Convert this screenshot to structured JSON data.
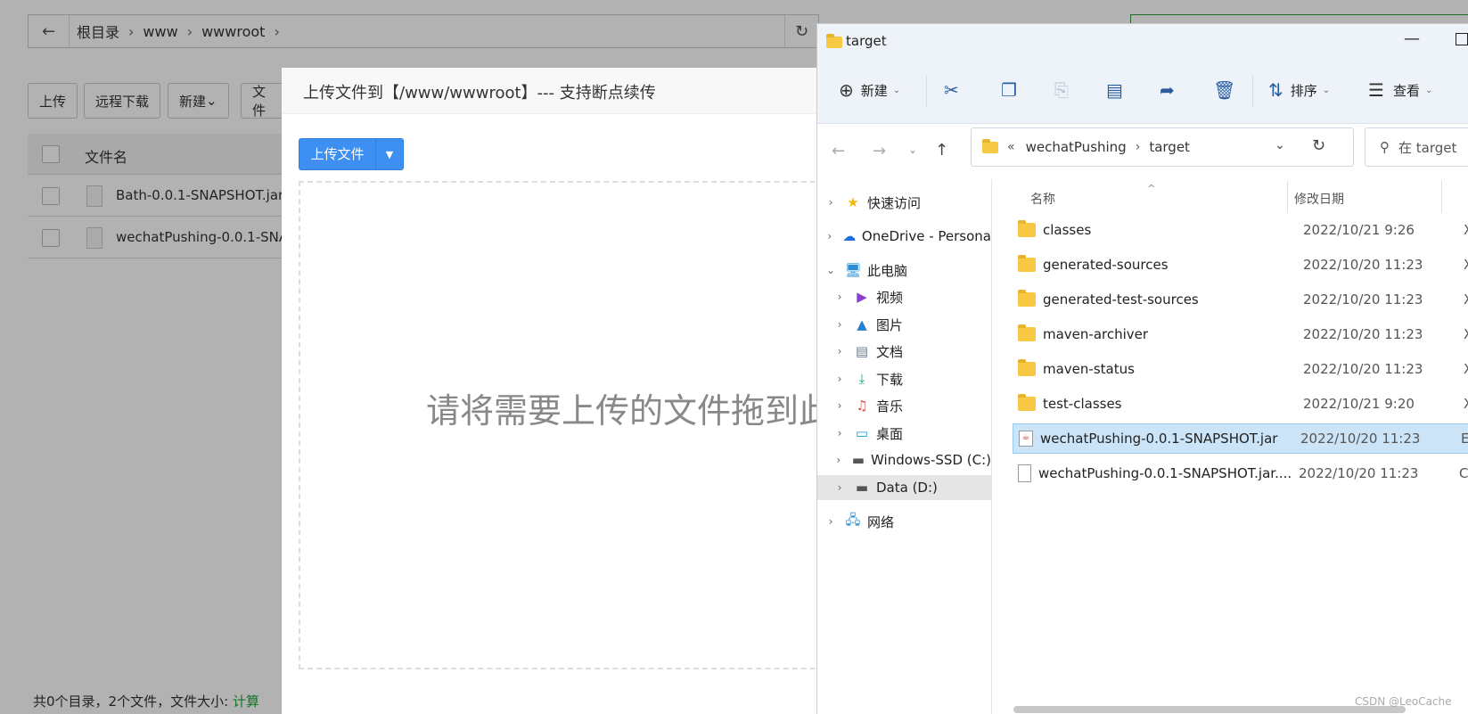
{
  "breadcrumb": {
    "items": [
      "根目录",
      "www",
      "wwwroot"
    ]
  },
  "toolbar": {
    "upload": "上传",
    "remote_download": "远程下载",
    "new": "新建",
    "file_more": "文件"
  },
  "file_list": {
    "header": "文件名",
    "rows": [
      {
        "name": "Bath-0.0.1-SNAPSHOT.jar"
      },
      {
        "name": "wechatPushing-0.0.1-SNA"
      }
    ]
  },
  "footer": {
    "summary": "共0个目录，2个文件，文件大小:",
    "calc_link": "计算"
  },
  "modal": {
    "title": "上传文件到【/www/wwwroot】--- 支持断点续传",
    "upload_button": "上传文件",
    "drop_hint": "请将需要上传的文件拖到此"
  },
  "explorer": {
    "title": "target",
    "toolbar": {
      "new": "新建",
      "sort": "排序",
      "view": "查看"
    },
    "address": {
      "prefix": "«",
      "parts": [
        "wechatPushing",
        "target"
      ]
    },
    "search_placeholder": "在 target",
    "nav": [
      {
        "label": "快速访问",
        "icon": "star-icon"
      },
      {
        "label": "OneDrive - Persona",
        "icon": "cloud-icon"
      },
      {
        "label": "此电脑",
        "icon": "computer-icon"
      },
      {
        "label": "视频",
        "icon": "video-icon"
      },
      {
        "label": "图片",
        "icon": "picture-icon"
      },
      {
        "label": "文档",
        "icon": "document-icon"
      },
      {
        "label": "下载",
        "icon": "download-icon"
      },
      {
        "label": "音乐",
        "icon": "music-icon"
      },
      {
        "label": "桌面",
        "icon": "desktop-icon"
      },
      {
        "label": "Windows-SSD (C:)",
        "icon": "drive-icon"
      },
      {
        "label": "Data (D:)",
        "icon": "drive-icon"
      },
      {
        "label": "网络",
        "icon": "network-icon"
      }
    ],
    "columns": {
      "name": "名称",
      "modified": "修改日期"
    },
    "files": [
      {
        "name": "classes",
        "date": "2022/10/21 9:26",
        "type": "X"
      },
      {
        "name": "generated-sources",
        "date": "2022/10/20 11:23",
        "type": "X"
      },
      {
        "name": "generated-test-sources",
        "date": "2022/10/20 11:23",
        "type": "X"
      },
      {
        "name": "maven-archiver",
        "date": "2022/10/20 11:23",
        "type": "X"
      },
      {
        "name": "maven-status",
        "date": "2022/10/20 11:23",
        "type": "X"
      },
      {
        "name": "test-classes",
        "date": "2022/10/21 9:20",
        "type": "X"
      },
      {
        "name": "wechatPushing-0.0.1-SNAPSHOT.jar",
        "date": "2022/10/20 11:23",
        "type": "E"
      },
      {
        "name": "wechatPushing-0.0.1-SNAPSHOT.jar....",
        "date": "2022/10/20 11:23",
        "type": "C"
      }
    ]
  },
  "watermark": "CSDN @LeoCache"
}
